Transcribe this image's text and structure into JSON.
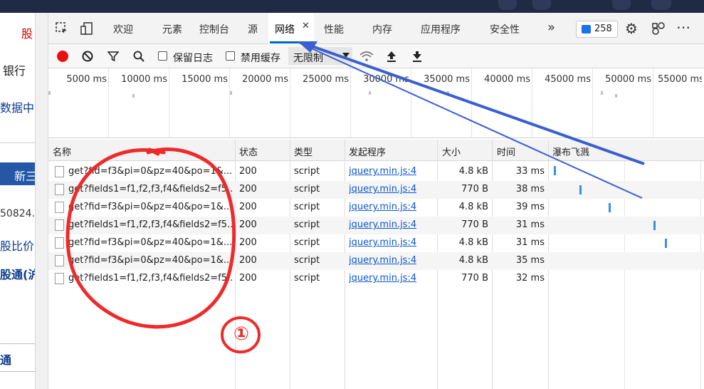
{
  "left_page": {
    "items": [
      "股",
      "银行",
      "数据中",
      "新三",
      "50824.",
      "股比价",
      "股通(沪",
      "通"
    ]
  },
  "devtools": {
    "tabs": [
      {
        "label": "欢迎"
      },
      {
        "label": "元素"
      },
      {
        "label": "控制台"
      },
      {
        "label": "源"
      },
      {
        "label": "网络",
        "active": true
      },
      {
        "label": "性能"
      },
      {
        "label": "内存"
      },
      {
        "label": "应用程序"
      },
      {
        "label": "安全性"
      }
    ],
    "close_glyph": "✕",
    "more_glyph": "»",
    "issues_count": "258",
    "settings_glyph": "⚙",
    "menu_glyph": "⋯"
  },
  "toolbar": {
    "preserve_log": "保留日志",
    "disable_cache": "禁用缓存",
    "throttle_value": "无限制"
  },
  "overview": {
    "ticks": [
      "5000 ms",
      "10000 ms",
      "15000 ms",
      "20000 ms",
      "25000 ms",
      "30000 ms",
      "35000 ms",
      "40000 ms",
      "45000 ms",
      "50000 ms",
      "55000 ms"
    ]
  },
  "grid": {
    "headers": {
      "name": "名称",
      "status": "状态",
      "type": "类型",
      "initiator": "发起程序",
      "size": "大小",
      "time": "时间",
      "waterfall": "瀑布飞溅"
    },
    "rows": [
      {
        "name": "get?fid=f3&pi=0&pz=40&po=1&...",
        "status": "200",
        "type": "script",
        "initiator": "jquery.min.js:4",
        "size": "4.8 kB",
        "time": "33 ms"
      },
      {
        "name": "get?fields1=f1,f2,f3,f4&fields2=f5...",
        "status": "200",
        "type": "script",
        "initiator": "jquery.min.js:4",
        "size": "770 B",
        "time": "38 ms"
      },
      {
        "name": "get?fid=f3&pi=0&pz=40&po=1&...",
        "status": "200",
        "type": "script",
        "initiator": "jquery.min.js:4",
        "size": "4.8 kB",
        "time": "39 ms"
      },
      {
        "name": "get?fields1=f1,f2,f3,f4&fields2=f5...",
        "status": "200",
        "type": "script",
        "initiator": "jquery.min.js:4",
        "size": "770 B",
        "time": "31 ms"
      },
      {
        "name": "get?fid=f3&pi=0&pz=40&po=1&...",
        "status": "200",
        "type": "script",
        "initiator": "jquery.min.js:4",
        "size": "4.8 kB",
        "time": "31 ms"
      },
      {
        "name": "get?fid=f3&pi=0&pz=40&po=1&...",
        "status": "200",
        "type": "script",
        "initiator": "jquery.min.js:4",
        "size": "4.8 kB",
        "time": "35 ms"
      },
      {
        "name": "get?fields1=f1,f2,f3,f4&fields2=f5...",
        "status": "200",
        "type": "script",
        "initiator": "jquery.min.js:4",
        "size": "770 B",
        "time": "32 ms"
      }
    ]
  },
  "annotation": {
    "label": "①",
    "circle_color": "#ee2a2a",
    "arrow_color": "#3a5fd0"
  }
}
